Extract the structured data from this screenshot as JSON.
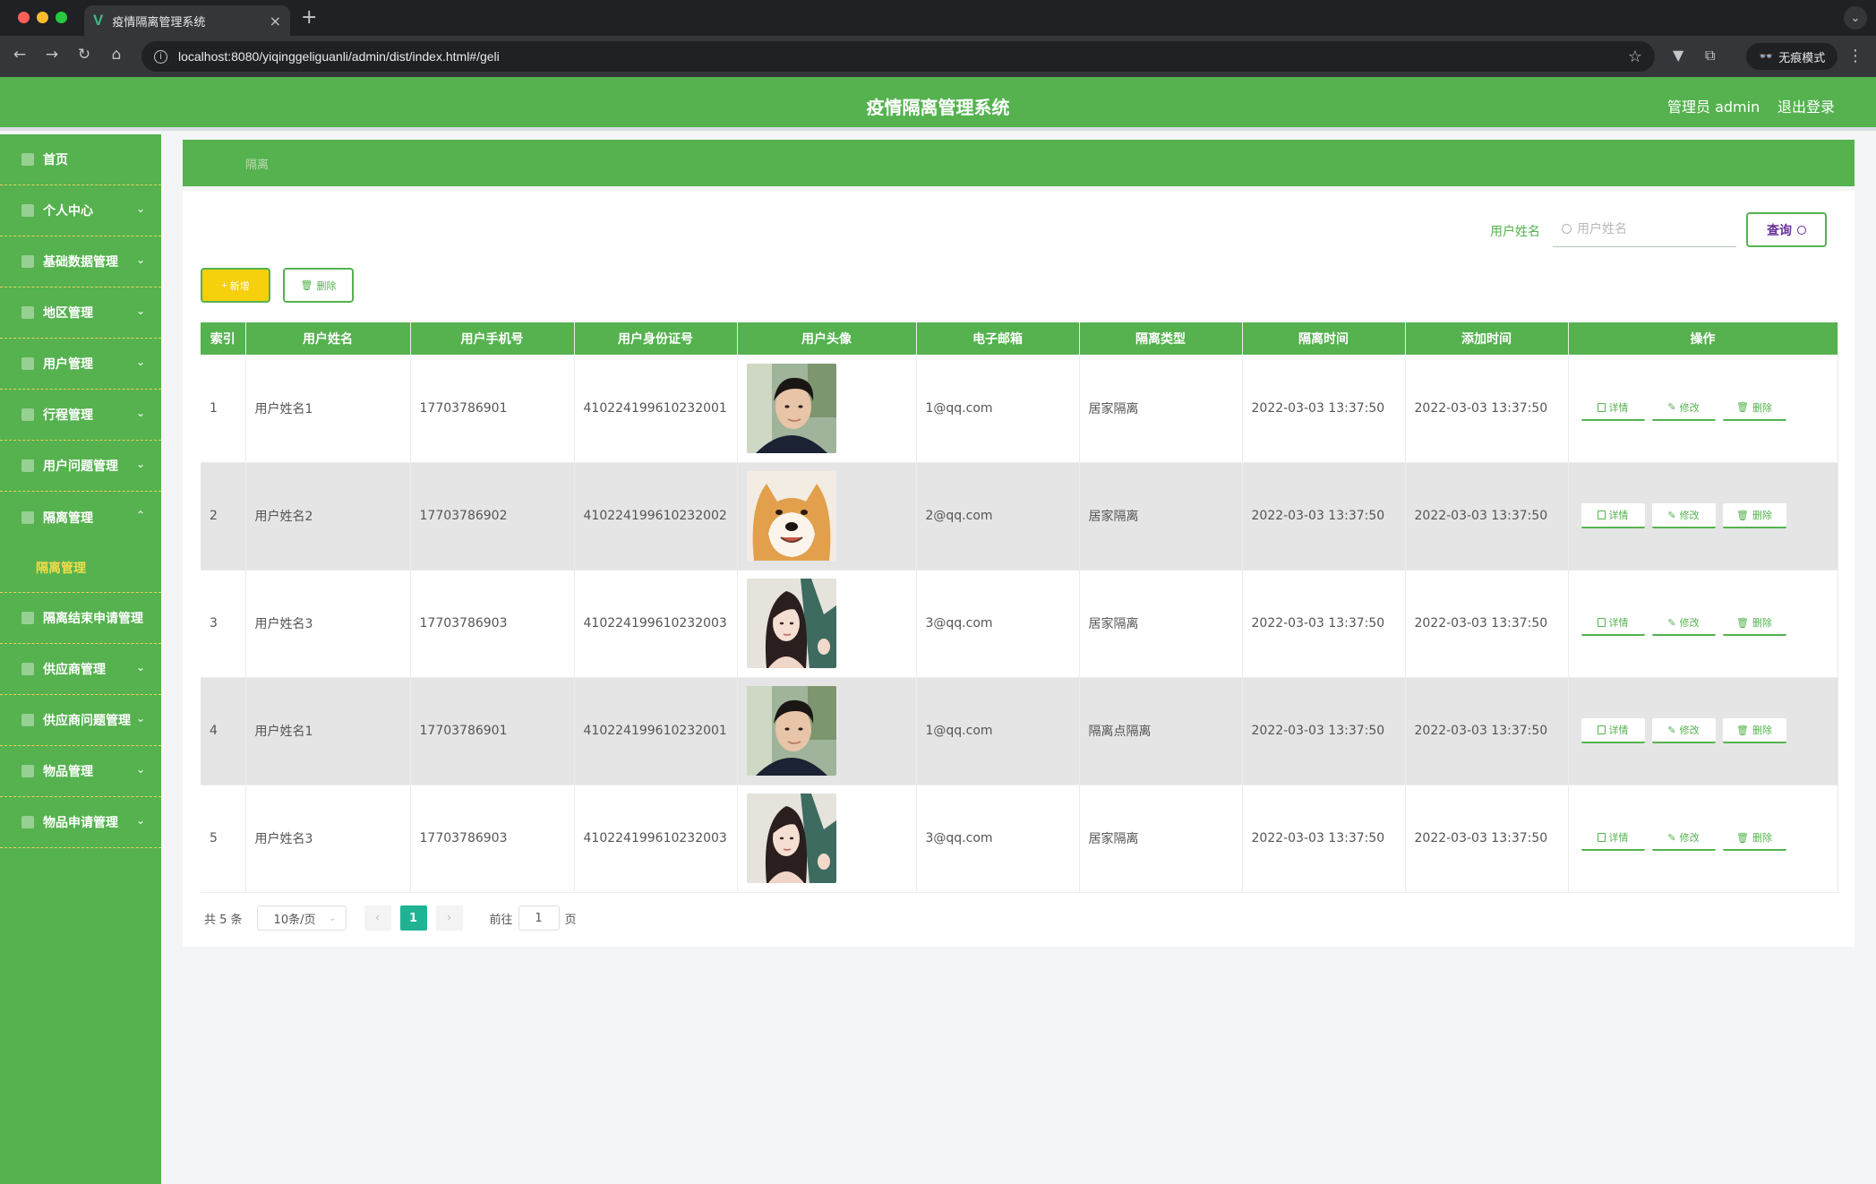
{
  "browser": {
    "tab_title": "疫情隔离管理系统",
    "tab_favicon": "V",
    "url": "localhost:8080/yiqinggeliguanli/admin/dist/index.html#/geli",
    "incognito_label": "无痕模式"
  },
  "header": {
    "title": "疫情隔离管理系统",
    "user": "管理员 admin",
    "logout": "退出登录"
  },
  "sidebar": {
    "items": [
      {
        "label": "首页"
      },
      {
        "label": "个人中心"
      },
      {
        "label": "基础数据管理"
      },
      {
        "label": "地区管理"
      },
      {
        "label": "用户管理"
      },
      {
        "label": "行程管理"
      },
      {
        "label": "用户问题管理"
      },
      {
        "label": "隔离管理"
      },
      {
        "label": "隔离结束申请管理"
      },
      {
        "label": "供应商管理"
      },
      {
        "label": "供应商问题管理"
      },
      {
        "label": "物品管理"
      },
      {
        "label": "物品申请管理"
      }
    ],
    "active_sub": "隔离管理"
  },
  "breadcrumb": "隔离",
  "search": {
    "label": "用户姓名",
    "placeholder": "用户姓名",
    "button": "查询"
  },
  "actions": {
    "add": "新增",
    "delete": "删除"
  },
  "table": {
    "columns": [
      "索引",
      "用户姓名",
      "用户手机号",
      "用户身份证号",
      "用户头像",
      "电子邮箱",
      "隔离类型",
      "隔离时间",
      "添加时间",
      "操作"
    ],
    "op_labels": {
      "detail": "详情",
      "edit": "修改",
      "delete": "删除"
    },
    "rows": [
      {
        "index": "1",
        "name": "用户姓名1",
        "phone": "17703786901",
        "id_card": "410224199610232001",
        "avatar": "man-portrait",
        "email": "1@qq.com",
        "type": "居家隔离",
        "geli_time": "2022-03-03 13:37:50",
        "add_time": "2022-03-03 13:37:50"
      },
      {
        "index": "2",
        "name": "用户姓名2",
        "phone": "17703786902",
        "id_card": "410224199610232002",
        "avatar": "shiba-dog",
        "email": "2@qq.com",
        "type": "居家隔离",
        "geli_time": "2022-03-03 13:37:50",
        "add_time": "2022-03-03 13:37:50"
      },
      {
        "index": "3",
        "name": "用户姓名3",
        "phone": "17703786903",
        "id_card": "410224199610232003",
        "avatar": "woman-illustration",
        "email": "3@qq.com",
        "type": "居家隔离",
        "geli_time": "2022-03-03 13:37:50",
        "add_time": "2022-03-03 13:37:50"
      },
      {
        "index": "4",
        "name": "用户姓名1",
        "phone": "17703786901",
        "id_card": "410224199610232001",
        "avatar": "man-portrait",
        "email": "1@qq.com",
        "type": "隔离点隔离",
        "geli_time": "2022-03-03 13:37:50",
        "add_time": "2022-03-03 13:37:50"
      },
      {
        "index": "5",
        "name": "用户姓名3",
        "phone": "17703786903",
        "id_card": "410224199610232003",
        "avatar": "woman-illustration",
        "email": "3@qq.com",
        "type": "居家隔离",
        "geli_time": "2022-03-03 13:37:50",
        "add_time": "2022-03-03 13:37:50"
      }
    ]
  },
  "pagination": {
    "total": "共 5 条",
    "page_size": "10条/页",
    "current": "1",
    "goto_label": "前往",
    "goto_value": "1",
    "page_suffix": "页"
  },
  "colors": {
    "primary_green": "#55b24f",
    "add_yellow": "#f6cf0d",
    "active_sub_yellow": "#f4dd48",
    "page_teal": "#1fb394",
    "query_purple": "#6a2f9b"
  }
}
